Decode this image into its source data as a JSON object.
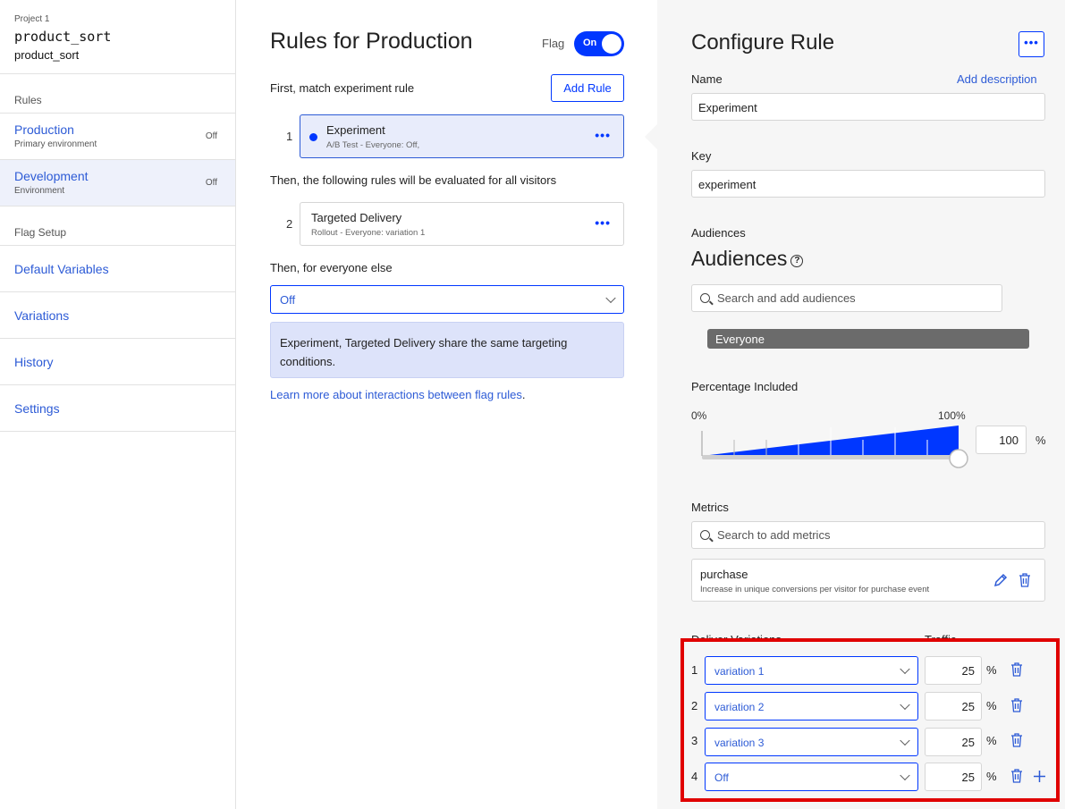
{
  "sidebar": {
    "project_label": "Project 1",
    "flag_key": "product_sort",
    "flag_name": "product_sort",
    "rules_heading": "Rules",
    "environments": [
      {
        "name": "Production",
        "subtitle": "Primary environment",
        "status": "Off"
      },
      {
        "name": "Development",
        "subtitle": "Environment",
        "status": "Off"
      }
    ],
    "setup_heading": "Flag Setup",
    "nav": [
      "Default Variables",
      "Variations",
      "History",
      "Settings"
    ]
  },
  "rules": {
    "title_prefix": "Rules for",
    "title_env": "Production",
    "flag_label": "Flag",
    "toggle_label": "On",
    "first_match_text": "First, match experiment rule",
    "add_rule_label": "Add Rule",
    "items": [
      {
        "number": "1",
        "title": "Experiment",
        "subtitle": "A/B Test - Everyone: Off,"
      },
      {
        "number": "2",
        "title": "Targeted Delivery",
        "subtitle": "Rollout - Everyone: variation 1"
      }
    ],
    "then_following_text": "Then, the following rules will be evaluated for all visitors",
    "then_everyone_text": "Then, for everyone else",
    "everyone_else_value": "Off",
    "info_text": "Experiment, Targeted Delivery share the same targeting conditions.",
    "learn_link": "Learn more about interactions between flag rules",
    "learn_period": "."
  },
  "config": {
    "title": "Configure Rule",
    "name_label": "Name",
    "add_description": "Add description",
    "name_value": "Experiment",
    "key_label": "Key",
    "key_value": "experiment",
    "audiences_label": "Audiences",
    "audiences_heading": "Audiences",
    "audience_search_placeholder": "Search and add audiences",
    "audience_chip": "Everyone",
    "percentage_label": "Percentage Included",
    "pct_min_label": "0%",
    "pct_max_label": "100%",
    "percentage_value": "100",
    "percentage_level": 100,
    "pct_sign": "%",
    "metrics_label": "Metrics",
    "metrics_search_placeholder": "Search to add metrics",
    "metric": {
      "name": "purchase",
      "description": "Increase in unique conversions per visitor for purchase event"
    },
    "deliver_variations_label": "Deliver Variations",
    "traffic_label": "Traffic",
    "variations": [
      {
        "number": "1",
        "variation": "variation 1",
        "traffic": "25",
        "pct": "%"
      },
      {
        "number": "2",
        "variation": "variation 2",
        "traffic": "25",
        "pct": "%"
      },
      {
        "number": "3",
        "variation": "variation 3",
        "traffic": "25",
        "pct": "%"
      },
      {
        "number": "4",
        "variation": "Off",
        "traffic": "25",
        "pct": "%"
      }
    ]
  },
  "colors": {
    "accent": "#0037ff",
    "link": "#2d5bd6",
    "highlight": "#e00000"
  }
}
